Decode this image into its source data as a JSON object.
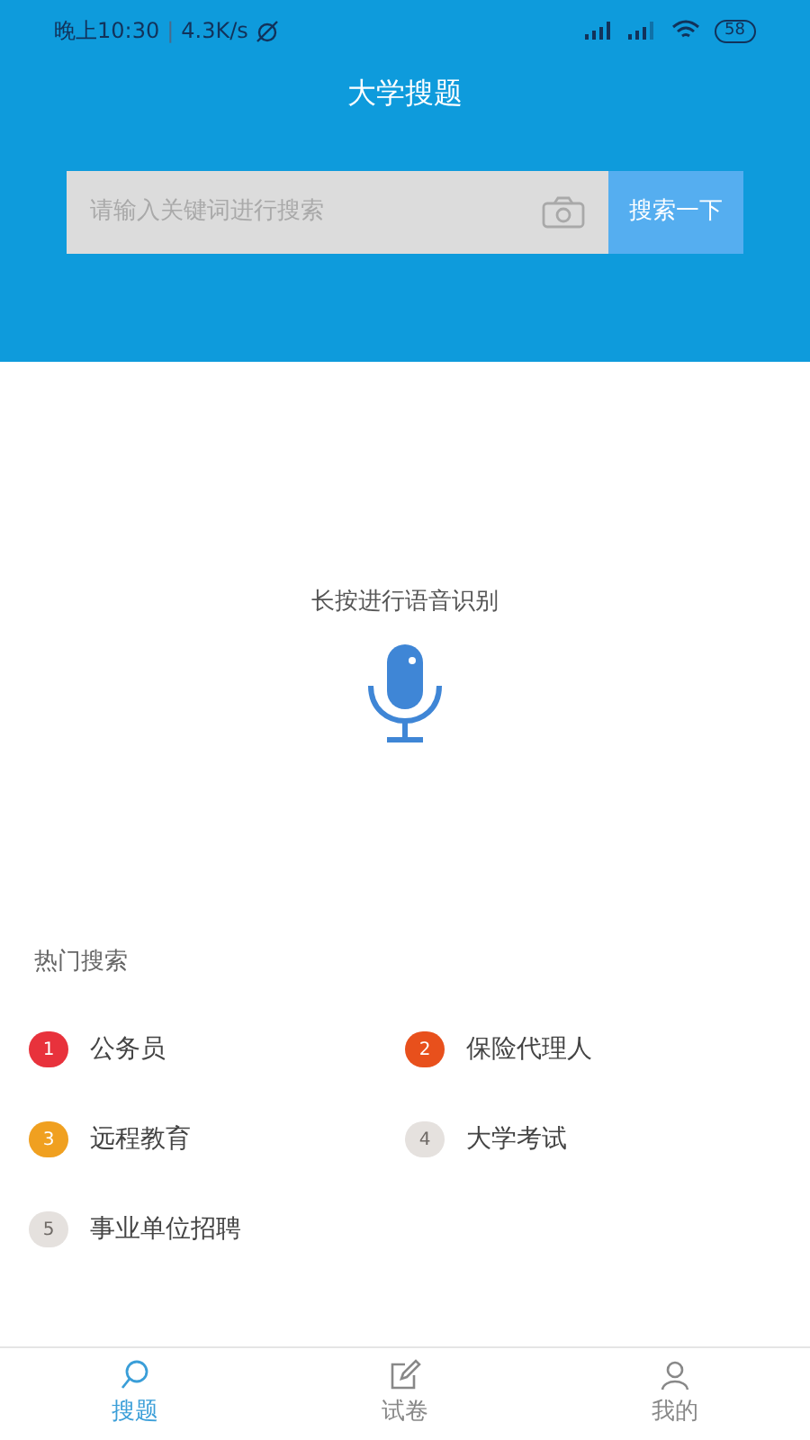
{
  "status_bar": {
    "time": "晚上10:30",
    "speed": "4.3K/s",
    "battery": "58",
    "separator": "|"
  },
  "header": {
    "title": "大学搜题"
  },
  "search": {
    "placeholder": "请输入关键词进行搜索",
    "button": "搜索一下"
  },
  "voice": {
    "hint": "长按进行语音识别"
  },
  "hot_search": {
    "title": "热门搜索",
    "items": [
      {
        "rank": "1",
        "label": "公务员",
        "color": "#e8323c"
      },
      {
        "rank": "2",
        "label": "保险代理人",
        "color": "#e8501c"
      },
      {
        "rank": "3",
        "label": "远程教育",
        "color": "#f0a020"
      },
      {
        "rank": "4",
        "label": "大学考试",
        "color": "#e5e1de"
      },
      {
        "rank": "5",
        "label": "事业单位招聘",
        "color": "#e5e1de"
      }
    ]
  },
  "tabs": [
    {
      "kind": "search",
      "label": "搜题",
      "selected": true
    },
    {
      "kind": "paper",
      "label": "试卷",
      "selected": false
    },
    {
      "kind": "me",
      "label": "我的",
      "selected": false
    }
  ]
}
